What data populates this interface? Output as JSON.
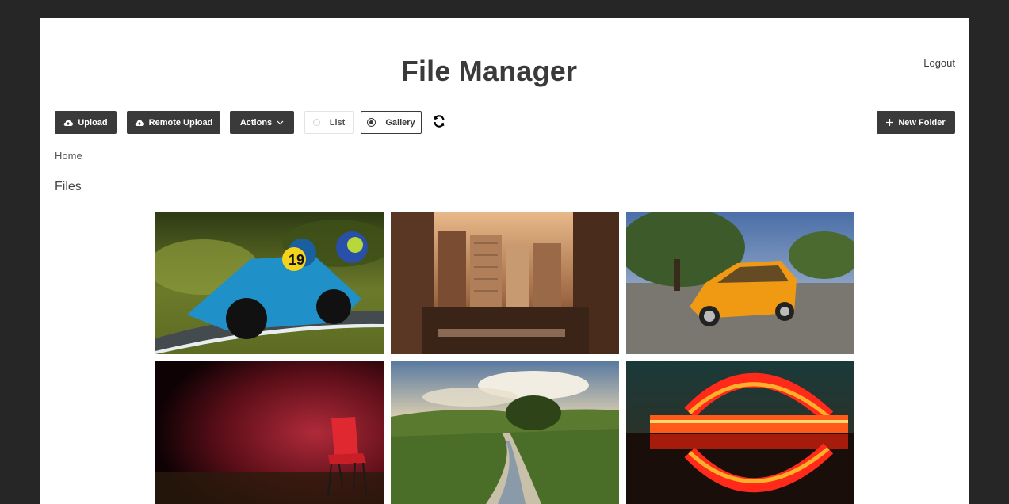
{
  "app": {
    "title": "File Manager",
    "logout_label": "Logout"
  },
  "toolbar": {
    "upload_label": "Upload",
    "remote_upload_label": "Remote Upload",
    "actions_label": "Actions",
    "view_list_label": "List",
    "view_gallery_label": "Gallery",
    "selected_view": "Gallery",
    "new_folder_label": "New Folder"
  },
  "breadcrumb": {
    "home_label": "Home"
  },
  "section": {
    "title": "Files"
  },
  "icons": {
    "upload": "cloud-upload-icon",
    "remote_upload": "cloud-upload-icon",
    "actions": "chevron-down-icon",
    "refresh": "refresh-icon",
    "new_folder": "plus-icon"
  },
  "colors": {
    "button_dark": "#3a3a3a",
    "page_background": "#262626",
    "panel": "#ffffff"
  },
  "gallery": [
    {
      "subject": "motorcycle racer"
    },
    {
      "subject": "city skyline at sunset"
    },
    {
      "subject": "orange car"
    },
    {
      "subject": "red chair"
    },
    {
      "subject": "river landscape"
    },
    {
      "subject": "illuminated building reflection"
    }
  ]
}
